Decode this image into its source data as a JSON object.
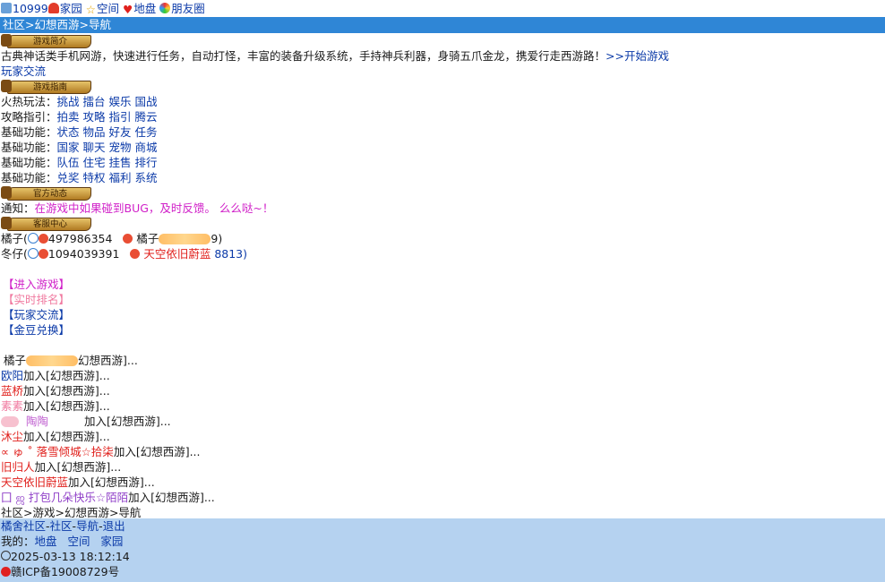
{
  "topbar": {
    "user_id": "10999",
    "links": [
      "家园",
      "空间",
      "地盘",
      "朋友圈"
    ]
  },
  "breadcrumb_top": {
    "parts": [
      "社区",
      "幻想西游",
      "导航"
    ],
    "sep": ">"
  },
  "sections": {
    "intro_banner": "游戏简介",
    "tips_banner": "游戏指南",
    "news_banner": "官方动态",
    "service_banner": "客服中心"
  },
  "intro": {
    "text": "古典神话类手机网游，快速进行任务，自动打怪，丰富的装备升级系统，手持神兵利器，身骑五爪金龙，携爱行走西游路！",
    "start_link": ">>开始游戏",
    "player_link": "玩家交流"
  },
  "guide": [
    {
      "label": "火热玩法：",
      "links": [
        "挑战",
        "擂台",
        "娱乐",
        "国战"
      ]
    },
    {
      "label": "攻略指引：",
      "links": [
        "拍卖",
        "攻略",
        "指引",
        "腾云"
      ]
    },
    {
      "label": "基础功能：",
      "links": [
        "状态",
        "物品",
        "好友",
        "任务"
      ]
    },
    {
      "label": "基础功能：",
      "links": [
        "国家",
        "聊天",
        "宠物",
        "商城"
      ]
    },
    {
      "label": "基础功能：",
      "links": [
        "队伍",
        "住宅",
        "挂售",
        "排行"
      ]
    },
    {
      "label": "基础功能：",
      "links": [
        "兑奖",
        "特权",
        "福利",
        "系统"
      ]
    }
  ],
  "notice": {
    "label": "通知：",
    "text": "在游戏中如果碰到BUG，及时反馈。 么么哒~！"
  },
  "service": [
    {
      "name": "橘子(",
      "qq": "497986354",
      "contact": "橘子",
      "suffix": "9)"
    },
    {
      "name": "冬仔(",
      "qq": "1094039391",
      "contact": "天空依旧蔚蓝",
      "suffix": "8813)"
    }
  ],
  "menu": [
    "【进入游戏】",
    "【实时排名】",
    "【玩家交流】",
    "【金豆兑换】"
  ],
  "joins": [
    {
      "name": "橘子",
      "text": "幻想西游]..."
    },
    {
      "name": "欧阳",
      "text": "加入[幻想西游]..."
    },
    {
      "name": "蓝桥",
      "text": "加入[幻想西游]..."
    },
    {
      "name": "素素",
      "text": "加入[幻想西游]..."
    },
    {
      "name": "陶陶",
      "text": "加入[幻想西游]..."
    },
    {
      "name": "沐尘",
      "text": "加入[幻想西游]..."
    },
    {
      "name": "∝ ゅ ˚ 落雪倾城☆拾柒",
      "text": "加入[幻想西游]..."
    },
    {
      "name": "旧归人",
      "text": "加入[幻想西游]..."
    },
    {
      "name": "天空依旧蔚蓝",
      "text": "加入[幻想西游]..."
    },
    {
      "name": "囗 ஜ 打包几朵快乐☆陌陌",
      "text": "加入[幻想西游]..."
    }
  ],
  "breadcrumb_bottom": "社区>游戏>幻想西游>导航",
  "footer": {
    "nav": [
      "橘舍社区",
      "社区",
      "导航",
      "退出"
    ],
    "mine_label": "我的：",
    "mine_links": [
      "地盘",
      "空间",
      "家园"
    ],
    "time": "2025-03-13 18:12:14",
    "icp": "赣ICP备19008729号"
  },
  "colors": {
    "header_blue": "#2f86d6",
    "footer_blue": "#b5d2f0",
    "link": "#0b3aa8"
  }
}
